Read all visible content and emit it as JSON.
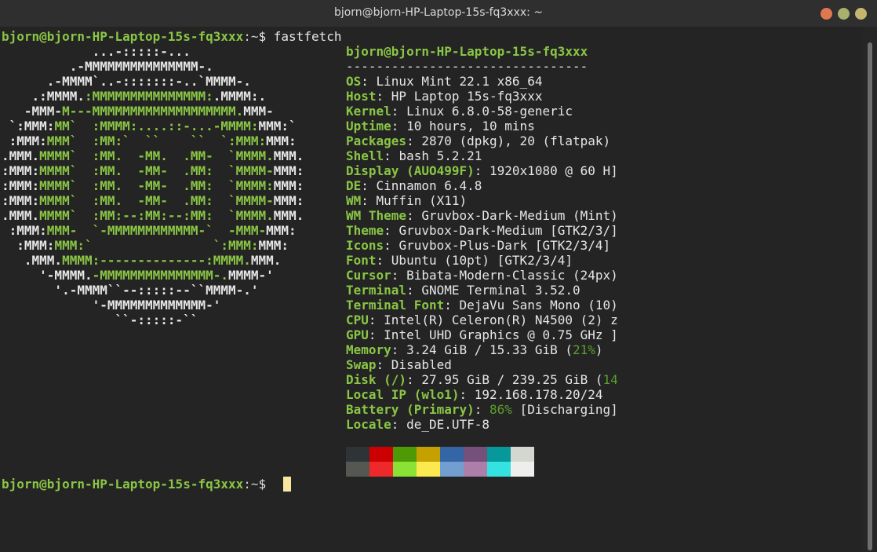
{
  "window": {
    "title": "bjorn@bjorn-HP-Laptop-15s-fq3xxx: ~"
  },
  "prompt": {
    "user_host": "bjorn@bjorn-HP-Laptop-15s-fq3xxx",
    "path": ":~",
    "symbol": "$ ",
    "command": "fastfetch"
  },
  "logo_lines": [
    [
      [
        "w",
        "            ...-:::::-..."
      ]
    ],
    [
      [
        "w",
        "         .-MMMMMMMMMMMMMMM-."
      ]
    ],
    [
      [
        "w",
        "      .-MMMM`..-:::::::-..`MMMM-."
      ]
    ],
    [
      [
        "w",
        "    .:MMMM."
      ],
      [
        "g",
        ":MMMMMMMMMMMMMMM:"
      ],
      [
        "w",
        ".MMMM:."
      ]
    ],
    [
      [
        "w",
        "   -MMM-"
      ],
      [
        "g",
        "M---MMMMMMMMMMMMMMMMMMM."
      ],
      [
        "w",
        "MMM-"
      ]
    ],
    [
      [
        "w",
        " `:MMM:"
      ],
      [
        "g",
        "MM`  :MMMM:....::-...-MMMM:"
      ],
      [
        "w",
        "MMM:`"
      ]
    ],
    [
      [
        "w",
        " :MMM:"
      ],
      [
        "g",
        "MMM`  :MM:`  ``    ``  `:MMM:"
      ],
      [
        "w",
        "MMM:"
      ]
    ],
    [
      [
        "w",
        ".MMM."
      ],
      [
        "g",
        "MMMM`  :MM.  -MM.  .MM-  `MMMM."
      ],
      [
        "w",
        "MMM."
      ]
    ],
    [
      [
        "w",
        ":MMM:"
      ],
      [
        "g",
        "MMMM`  :MM.  -MM-  .MM:  `MMMM-"
      ],
      [
        "w",
        "MMM:"
      ]
    ],
    [
      [
        "w",
        ":MMM:"
      ],
      [
        "g",
        "MMMM`  :MM.  -MM-  .MM:  `MMMM:"
      ],
      [
        "w",
        "MMM:"
      ]
    ],
    [
      [
        "w",
        ":MMM:"
      ],
      [
        "g",
        "MMMM`  :MM.  -MM-  .MM:  `MMMM-"
      ],
      [
        "w",
        "MMM:"
      ]
    ],
    [
      [
        "w",
        ".MMM."
      ],
      [
        "g",
        "MMMM`  :MM:--:MM:--:MM:  `MMMM."
      ],
      [
        "w",
        "MMM."
      ]
    ],
    [
      [
        "w",
        " :MMM:"
      ],
      [
        "g",
        "MMM-  `-MMMMMMMMMMMM-`  -MMM-"
      ],
      [
        "w",
        "MMM:"
      ]
    ],
    [
      [
        "w",
        "  :MMM:"
      ],
      [
        "g",
        "MMM:`                `:MMM:"
      ],
      [
        "w",
        "MMM:"
      ]
    ],
    [
      [
        "w",
        "   .MMM."
      ],
      [
        "g",
        "MMMM:--------------:MMMM."
      ],
      [
        "w",
        "MMM."
      ]
    ],
    [
      [
        "w",
        "     '-MMMM."
      ],
      [
        "g",
        "-MMMMMMMMMMMMMMM-."
      ],
      [
        "w",
        "MMMM-'"
      ]
    ],
    [
      [
        "w",
        "       '.-MMMM``--:::::--``MMMM-.'"
      ]
    ],
    [
      [
        "w",
        "            '-MMMMMMMMMMMMM-'"
      ]
    ],
    [
      [
        "w",
        "               ``-:::::-``"
      ]
    ]
  ],
  "info": {
    "header": "bjorn@bjorn-HP-Laptop-15s-fq3xxx",
    "separator": "--------------------------------",
    "rows": [
      {
        "key": "OS",
        "value": "Linux Mint 22.1 x86_64"
      },
      {
        "key": "Host",
        "value": "HP Laptop 15s-fq3xxx"
      },
      {
        "key": "Kernel",
        "value": "Linux 6.8.0-58-generic"
      },
      {
        "key": "Uptime",
        "value": "10 hours, 10 mins"
      },
      {
        "key": "Packages",
        "value": "2870 (dpkg), 20 (flatpak)"
      },
      {
        "key": "Shell",
        "value": "bash 5.2.21"
      },
      {
        "key": "Display (AUO499F)",
        "value": "1920x1080 @ 60 H]"
      },
      {
        "key": "DE",
        "value": "Cinnamon 6.4.8"
      },
      {
        "key": "WM",
        "value": "Muffin (X11)"
      },
      {
        "key": "WM Theme",
        "value": "Gruvbox-Dark-Medium (Mint)"
      },
      {
        "key": "Theme",
        "value": "Gruvbox-Dark-Medium [GTK2/3/]"
      },
      {
        "key": "Icons",
        "value": "Gruvbox-Plus-Dark [GTK2/3/4]"
      },
      {
        "key": "Font",
        "value": "Ubuntu (10pt) [GTK2/3/4]"
      },
      {
        "key": "Cursor",
        "value": "Bibata-Modern-Classic (24px)"
      },
      {
        "key": "Terminal",
        "value": "GNOME Terminal 3.52.0"
      },
      {
        "key": "Terminal Font",
        "value": "DejaVu Sans Mono (10)"
      },
      {
        "key": "CPU",
        "value": "Intel(R) Celeron(R) N4500 (2) z"
      },
      {
        "key": "GPU",
        "value": "Intel UHD Graphics @ 0.75 GHz ]"
      },
      {
        "key": "Memory",
        "value": "3.24 GiB / 15.33 GiB (",
        "pct": "21%",
        "tail": ")"
      },
      {
        "key": "Swap",
        "value": "Disabled"
      },
      {
        "key": "Disk (/)",
        "value": "27.95 GiB / 239.25 GiB (",
        "pct": "14",
        "tail": ""
      },
      {
        "key": "Local IP (wlo1)",
        "value": "192.168.178.20/24"
      },
      {
        "key": "Battery (Primary)",
        "value": "",
        "pct": "86%",
        "tail": " [Discharging]"
      },
      {
        "key": "Locale",
        "value": "de_DE.UTF-8"
      }
    ]
  },
  "palette": {
    "row1": [
      "#2e3436",
      "#cc0000",
      "#4e9a06",
      "#c4a000",
      "#3465a4",
      "#75507b",
      "#06989a",
      "#d3d7cf"
    ],
    "row2": [
      "#555753",
      "#ef2929",
      "#8ae234",
      "#fce94f",
      "#729fcf",
      "#ad7fa8",
      "#34e2e2",
      "#eeeeec"
    ]
  },
  "final_prompt": {
    "user_host": "bjorn@bjorn-HP-Laptop-15s-fq3xxx",
    "path": ":~",
    "symbol": "$ "
  }
}
